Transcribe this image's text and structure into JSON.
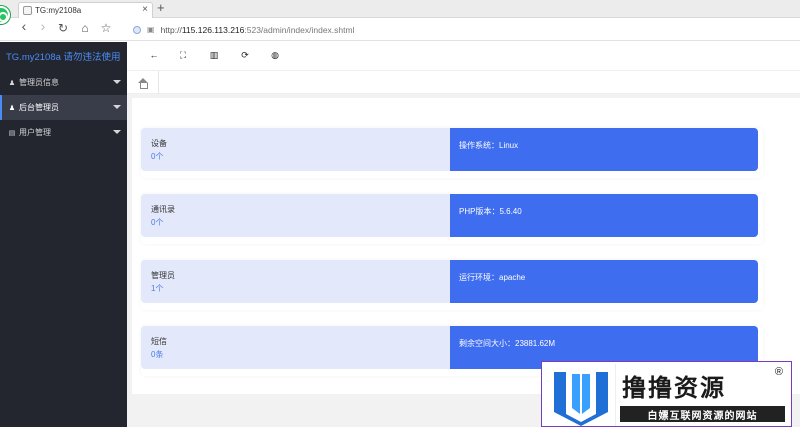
{
  "browser": {
    "tab_title": "TG:my2108a",
    "tab_close": "×",
    "new_tab": "+",
    "nav": {
      "back": "‹",
      "forward": "›",
      "reload": "↻",
      "home": "⌂",
      "star": "☆"
    },
    "url_proto": "http://",
    "url_host": "115.126.113.216",
    "url_rest": ":523/admin/index/index.shtml"
  },
  "sidebar": {
    "brand": "TG.my2108a 请勿违法使用",
    "items": [
      {
        "label": "管理员信息",
        "icon": "user-icon",
        "glyph": "♟"
      },
      {
        "label": "后台管理员",
        "icon": "user-icon",
        "glyph": "♟"
      },
      {
        "label": "用户管理",
        "icon": "id-card-icon",
        "glyph": "▤"
      }
    ]
  },
  "toolbar": {
    "icons": [
      {
        "name": "arrow-left-icon",
        "glyph": "←"
      },
      {
        "name": "fullscreen-icon",
        "glyph": "⛶"
      },
      {
        "name": "bank-icon",
        "glyph": "▥"
      },
      {
        "name": "refresh-icon",
        "glyph": "⟳"
      },
      {
        "name": "globe-icon",
        "glyph": "◍"
      }
    ]
  },
  "cards": [
    {
      "label": "设备",
      "value": "0个",
      "info": "操作系统：Linux"
    },
    {
      "label": "通讯录",
      "value": "0个",
      "info": "PHP版本：5.6.40"
    },
    {
      "label": "管理员",
      "value": "1个",
      "info": "运行环境：apache"
    },
    {
      "label": "短信",
      "value": "0条",
      "info": "剩余空间大小：23881.62M"
    }
  ],
  "watermark": {
    "title": "撸撸资源",
    "reg": "®",
    "subtitle": "白嫖互联网资源的网站"
  },
  "colors": {
    "sidebar_bg": "#23262e",
    "accent": "#4a8cf7",
    "card_left_bg": "#e3e8fb",
    "card_right_bg": "#3f6df0"
  }
}
